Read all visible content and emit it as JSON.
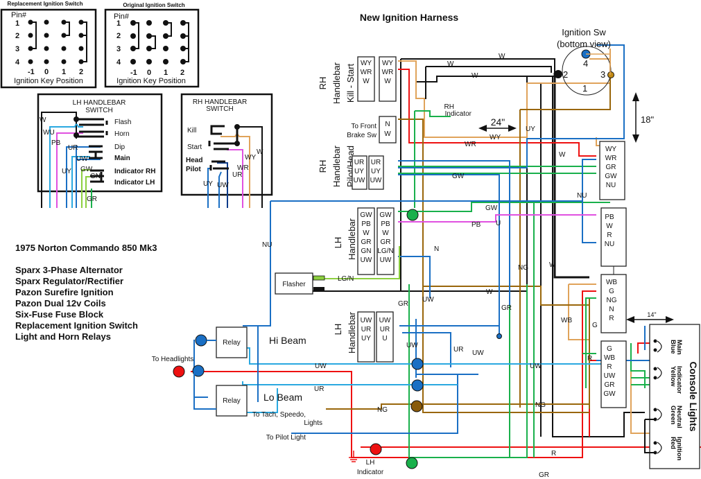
{
  "title": "New Ignition Harness",
  "specs": {
    "title": "1975 Norton Commando 850 Mk3",
    "items": [
      "Sparx 3-Phase Alternator",
      "Sparx Regulator/Rectifier",
      "Pazon Surefire Ignition",
      "Pazon Dual 12v Coils",
      "Six-Fuse Fuse Block",
      "Replacement Ignition Switch",
      "Light and Horn Relays"
    ]
  },
  "switch_tables": {
    "replacement": {
      "title": "Replacement Ignition Switch",
      "pin_label": "Pin#",
      "pins": [
        "1",
        "2",
        "3",
        "4"
      ],
      "positions": [
        "-1",
        "0",
        "1",
        "2"
      ],
      "axis_label": "Ignition Key Position"
    },
    "original": {
      "title": "Original Ignition Switch",
      "pin_label": "Pin#",
      "pins": [
        "1",
        "2",
        "3",
        "4"
      ],
      "positions": [
        "-1",
        "0",
        "1",
        "2"
      ],
      "axis_label": "Ignition Key Position"
    }
  },
  "lh_switch": {
    "title": "LH HANDLEBAR",
    "subtitle": "SWITCH",
    "functions": [
      "Flash",
      "Horn",
      "Dip",
      "Main",
      "Indicator RH",
      "Indicator LH"
    ],
    "wires": [
      "W",
      "WU",
      "PB",
      "UR",
      "UY",
      "UW",
      "GW",
      "GN",
      "GR"
    ]
  },
  "rh_switch": {
    "title": "RH HANDLEBAR",
    "subtitle": "SWITCH",
    "functions": [
      "Kill",
      "Start",
      "Head",
      "Pilot"
    ],
    "wires": [
      "UY",
      "UW",
      "UR",
      "WR",
      "WY",
      "W"
    ]
  },
  "ignition_sw": {
    "title": "Ignition Sw",
    "subtitle": "(bottom view)",
    "pins": [
      "1",
      "2",
      "3",
      "4"
    ]
  },
  "dimensions": {
    "d24": "24\"",
    "d18": "18\"",
    "d14": "14\""
  },
  "connectors": {
    "rh_kill_start": {
      "label": [
        "RH",
        "Handlebar",
        "Kill - Start"
      ],
      "pins": [
        "WY",
        "WR",
        "W"
      ]
    },
    "front_brake": {
      "label": "To Front Brake Sw",
      "pins": [
        "N",
        "W"
      ]
    },
    "rh_pilot_head": {
      "label": [
        "RH",
        "Handlebar",
        "Pilot/Head"
      ],
      "pins": [
        "UR",
        "UY",
        "UW"
      ]
    },
    "lh_handlebar_1": {
      "label": [
        "LH",
        "Handlebar"
      ],
      "pins": [
        "GW",
        "PB",
        "W",
        "GR",
        "GN",
        "UW"
      ],
      "pins_right": [
        "GW",
        "PB",
        "W",
        "GR",
        "LG/N",
        "UW"
      ]
    },
    "lh_handlebar_2": {
      "label": [
        "LH",
        "Handlebar"
      ],
      "pins": [
        "UW",
        "UR",
        "UY"
      ],
      "pins_right": [
        "UW",
        "UR",
        "U"
      ]
    },
    "block_a": [
      "WY",
      "WR",
      "GR",
      "GW",
      "NU"
    ],
    "block_b": [
      "PB",
      "W",
      "R",
      "NU"
    ],
    "block_c": [
      "WB",
      "G",
      "NG",
      "N",
      "R"
    ],
    "block_d": [
      "G",
      "WB",
      "R",
      "UW",
      "GR",
      "GW"
    ]
  },
  "components": {
    "flasher": "Flasher",
    "relay": "Relay",
    "hi_beam": "Hi Beam",
    "lo_beam": "Lo Beam",
    "to_headlights": "To Headlights",
    "to_tach": "To Tach, Speedo,",
    "to_tach2": "Lights",
    "to_pilot": "To Pilot Light",
    "rh_indicator": "RH",
    "rh_indicator2": "Indicator",
    "lh_indicator": "LH",
    "lh_indicator2": "Indicator"
  },
  "console": {
    "title": "Console Lights",
    "lamps": [
      {
        "name": "Main",
        "color": "Blue"
      },
      {
        "name": "Indicator",
        "color": "Yellow"
      },
      {
        "name": "Neutral",
        "color": "Green"
      },
      {
        "name": "Ignition",
        "color": "Red"
      }
    ]
  },
  "wire_labels": {
    "w": "W",
    "wy": "WY",
    "wr": "WR",
    "uy": "UY",
    "gw": "GW",
    "pb": "PB",
    "u": "U",
    "n": "N",
    "ng": "NG",
    "nu": "NU",
    "gr": "GR",
    "uw": "UW",
    "ur": "UR",
    "lgn": "LG/N",
    "wb": "WB",
    "g": "G",
    "r": "R"
  },
  "colors": {
    "black": "#111111",
    "blue": "#1a6fc4",
    "lightblue": "#29a8e0",
    "red": "#ee1111",
    "green": "#19b04b",
    "lightgreen": "#8ccf3f",
    "brown": "#99660a",
    "tan": "#e0a35a",
    "pink": "#e050e0",
    "darkblue": "#0c3b8a"
  }
}
